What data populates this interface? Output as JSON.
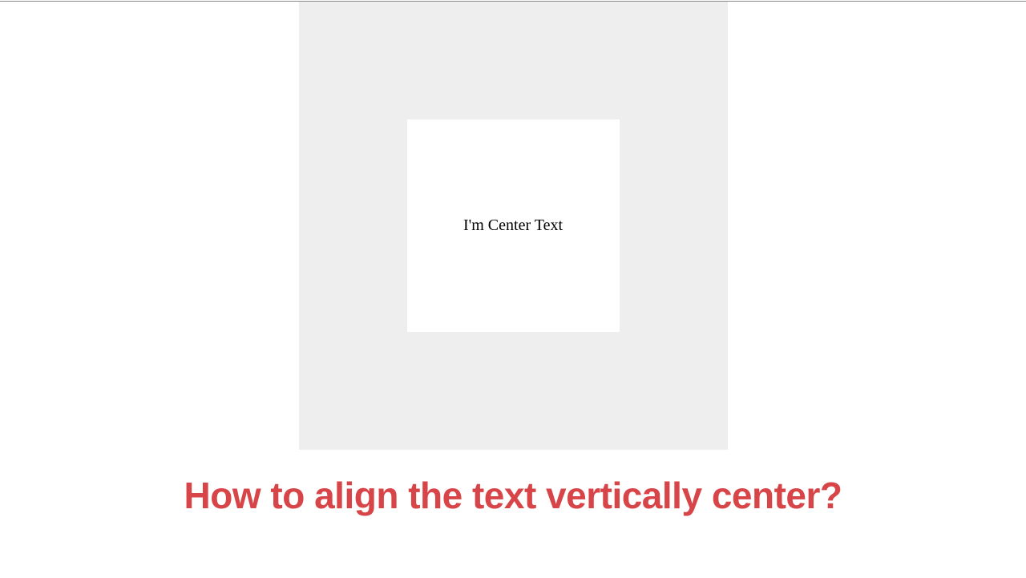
{
  "demo": {
    "center_text": "I'm Center Text"
  },
  "heading": {
    "text": "How to align the text vertically center?"
  },
  "colors": {
    "heading_color": "#d74549",
    "container_bg": "#eeeeee",
    "inner_box_bg": "#ffffff"
  }
}
